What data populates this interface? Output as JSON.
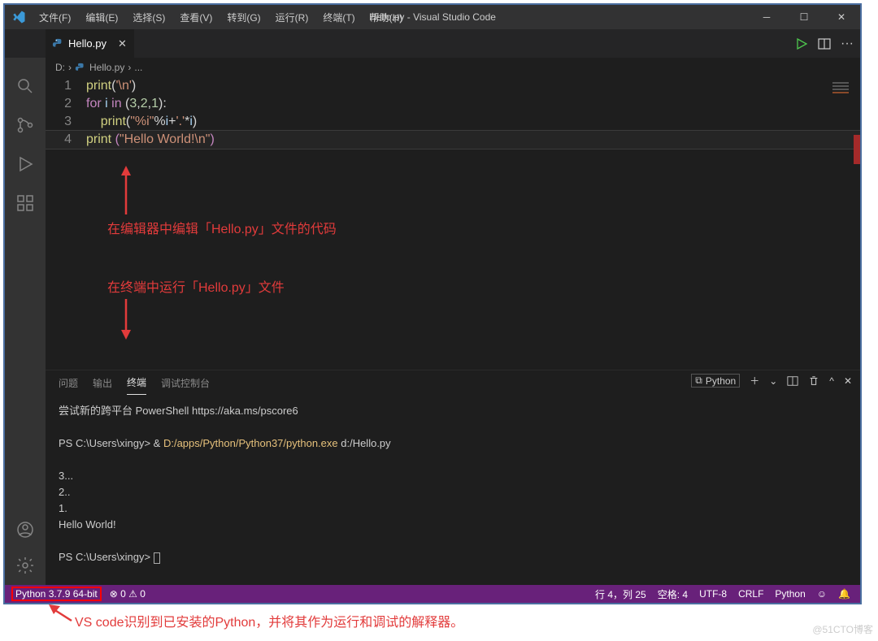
{
  "titleBar": {
    "menus": [
      "文件(F)",
      "编辑(E)",
      "选择(S)",
      "查看(V)",
      "转到(G)",
      "运行(R)",
      "终端(T)",
      "帮助(H)"
    ],
    "title": "Hello.py - Visual Studio Code"
  },
  "tab": {
    "filename": "Hello.py"
  },
  "breadcrumbs": {
    "drive": "D:",
    "file": "Hello.py",
    "more": "..."
  },
  "code": {
    "lines": [
      {
        "n": "1",
        "tokens": [
          {
            "t": "print",
            "c": "fn"
          },
          {
            "t": "(",
            "c": ""
          },
          {
            "t": "'\\n'",
            "c": "str"
          },
          {
            "t": ")",
            "c": ""
          }
        ]
      },
      {
        "n": "2",
        "tokens": [
          {
            "t": "for ",
            "c": "kw"
          },
          {
            "t": "i",
            "c": "var"
          },
          {
            "t": " in ",
            "c": "kw"
          },
          {
            "t": "(",
            "c": ""
          },
          {
            "t": "3",
            "c": "num"
          },
          {
            "t": ",",
            "c": ""
          },
          {
            "t": "2",
            "c": "num"
          },
          {
            "t": ",",
            "c": ""
          },
          {
            "t": "1",
            "c": "num"
          },
          {
            "t": "):",
            "c": ""
          }
        ]
      },
      {
        "n": "3",
        "tokens": [
          {
            "t": "    ",
            "c": ""
          },
          {
            "t": "print",
            "c": "fn"
          },
          {
            "t": "(",
            "c": ""
          },
          {
            "t": "\"%i\"",
            "c": "str"
          },
          {
            "t": "%",
            "c": ""
          },
          {
            "t": "i",
            "c": "var"
          },
          {
            "t": "+",
            "c": ""
          },
          {
            "t": "'.'",
            "c": "str"
          },
          {
            "t": "*",
            "c": ""
          },
          {
            "t": "i",
            "c": "var"
          },
          {
            "t": ")",
            "c": ""
          }
        ]
      },
      {
        "n": "4",
        "tokens": [
          {
            "t": "print",
            "c": "fn"
          },
          {
            "t": " ",
            "c": ""
          },
          {
            "t": "(",
            "c": "brkt"
          },
          {
            "t": "\"Hello World!\\n\"",
            "c": "str"
          },
          {
            "t": ")",
            "c": "brkt"
          }
        ],
        "current": true
      }
    ]
  },
  "annotations": {
    "edit": "在编辑器中编辑「Hello.py」文件的代码",
    "run": "在终端中运行「Hello.py」文件",
    "bottom": "VS code识别到已安装的Python，并将其作为运行和调试的解释器。"
  },
  "panel": {
    "tabs": [
      "问题",
      "输出",
      "终端",
      "调试控制台"
    ],
    "activeIndex": 2,
    "badge": "Python",
    "terminal": {
      "line1": "尝试新的跨平台 PowerShell https://aka.ms/pscore6",
      "prompt1": "PS C:\\Users\\xingy> & ",
      "cmd": "D:/apps/Python/Python37/python.exe",
      "arg": " d:/Hello.py",
      "out": [
        "",
        "3...",
        "2..",
        "1.",
        "Hello World!",
        ""
      ],
      "prompt2": "PS C:\\Users\\xingy> "
    }
  },
  "status": {
    "python": "Python 3.7.9 64-bit",
    "errwarn": "⊗ 0 ⚠ 0",
    "pos": "行 4，列 25",
    "spaces": "空格: 4",
    "encoding": "UTF-8",
    "eol": "CRLF",
    "lang": "Python",
    "feedback": "☺",
    "bell": "🔔"
  },
  "watermark": "@51CTO博客"
}
